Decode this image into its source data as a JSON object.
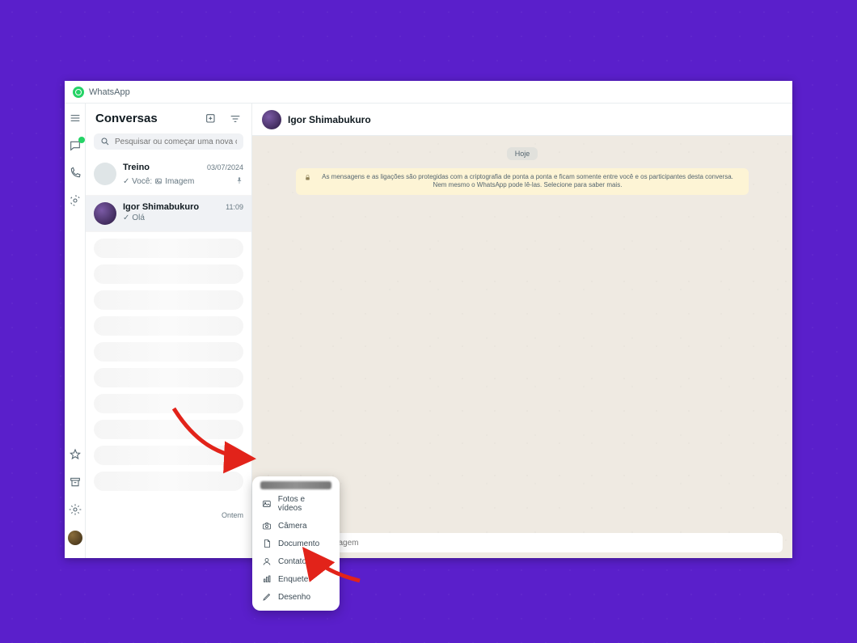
{
  "app_title": "WhatsApp",
  "sidebar_title": "Conversas",
  "search": {
    "placeholder": "Pesquisar ou começar uma nova conversa"
  },
  "conversations": [
    {
      "name": "Treino",
      "timestamp": "03/07/2024",
      "preview_prefix": "✓ Você:",
      "preview_icon": "image",
      "preview_text": "Imagem",
      "pinned": true,
      "active": false
    },
    {
      "name": "Igor Shimabukuro",
      "timestamp": "11:09",
      "preview_prefix": "✓",
      "preview_text": "Olá",
      "pinned": false,
      "active": true
    }
  ],
  "bottom_time_label": "Ontem",
  "chat": {
    "header_name": "Igor Shimabukuro",
    "date_chip": "Hoje",
    "e2e_notice": "As mensagens e as ligações são protegidas com a criptografia de ponta a ponta e ficam somente entre você e os participantes desta conversa. Nem mesmo o WhatsApp pode lê-las. Selecione para saber mais.",
    "input_placeholder": "Mensagem"
  },
  "attach_menu": {
    "photos_videos": "Fotos e vídeos",
    "camera": "Câmera",
    "document": "Documento",
    "contact": "Contato",
    "poll": "Enquete",
    "drawing": "Desenho"
  },
  "colors": {
    "brand_green": "#25d366",
    "page_bg": "#5a1fcb",
    "annotation_red": "#e2231a"
  }
}
